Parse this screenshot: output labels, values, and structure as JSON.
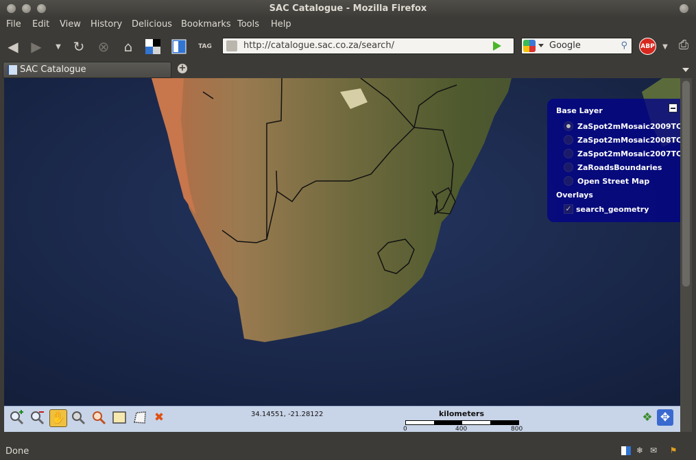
{
  "window": {
    "title": "SAC Catalogue - Mozilla Firefox"
  },
  "menubar": {
    "items": [
      "File",
      "Edit",
      "View",
      "History",
      "Delicious",
      "Bookmarks",
      "Tools",
      "Help"
    ]
  },
  "toolbar": {
    "url": "http://catalogue.sac.co.za/search/",
    "search_engine": "Google",
    "search_placeholder": "Google",
    "abp_label": "ABP"
  },
  "tabs": [
    {
      "label": "SAC Catalogue"
    }
  ],
  "map": {
    "layer_switcher": {
      "base_layer_heading": "Base Layer",
      "base_layers": [
        {
          "label": "ZaSpot2mMosaic2009TC",
          "selected": true
        },
        {
          "label": "ZaSpot2mMosaic2008TC",
          "selected": false
        },
        {
          "label": "ZaSpot2mMosaic2007TC",
          "selected": false
        },
        {
          "label": "ZaRoadsBoundaries",
          "selected": false
        },
        {
          "label": "Open Street Map",
          "selected": false
        }
      ],
      "overlays_heading": "Overlays",
      "overlays": [
        {
          "label": "search_geometry",
          "checked": true
        }
      ]
    },
    "toolbar": {
      "tools": [
        "zoom-in-icon",
        "zoom-out-icon",
        "pan-hand-icon",
        "zoom-previous-icon",
        "zoom-next-icon",
        "draw-box-icon",
        "draw-polygon-icon",
        "clear-icon"
      ],
      "active_tool": "pan-hand-icon",
      "coordinates": "34.14551, -21.28122",
      "scale": {
        "unit": "kilometers",
        "ticks": [
          "0",
          "400",
          "800"
        ]
      }
    }
  },
  "statusbar": {
    "text": "Done"
  },
  "colors": {
    "layer_panel": "#00008b",
    "map_toolbar": "#c8d4e8",
    "window_chrome": "#3c3b37"
  }
}
